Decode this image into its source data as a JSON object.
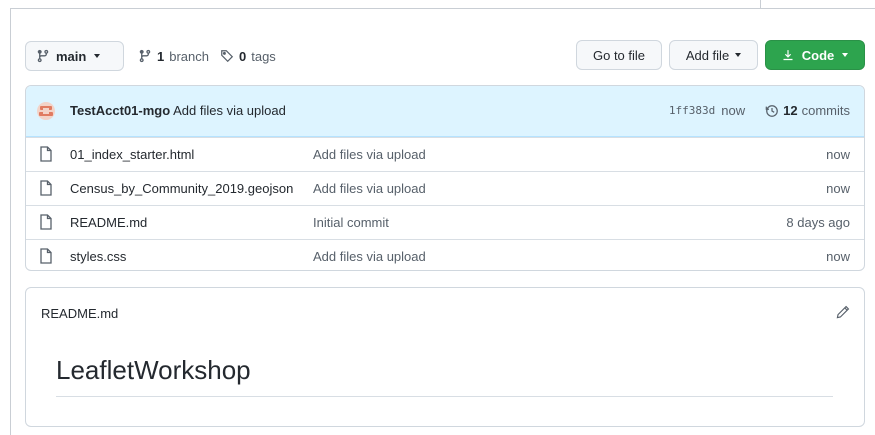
{
  "toolbar": {
    "branch_label": "main",
    "branch_count": "1",
    "branch_word": "branch",
    "tag_count": "0",
    "tag_word": "tags",
    "go_to_file": "Go to file",
    "add_file": "Add file",
    "code": "Code"
  },
  "commit": {
    "author": "TestAcct01-mgo",
    "message": "Add files via upload",
    "sha": "1ff383d",
    "when": "now",
    "commit_count": "12",
    "commit_word": "commits"
  },
  "files": [
    {
      "name": "01_index_starter.html",
      "commit": "Add files via upload",
      "age": "now"
    },
    {
      "name": "Census_by_Community_2019.geojson",
      "commit": "Add files via upload",
      "age": "now"
    },
    {
      "name": "README.md",
      "commit": "Initial commit",
      "age": "8 days ago"
    },
    {
      "name": "styles.css",
      "commit": "Add files via upload",
      "age": "now"
    }
  ],
  "readme": {
    "filename": "README.md",
    "heading": "LeafletWorkshop"
  },
  "colors": {
    "accent_green": "#2da44e",
    "commit_bar_bg": "#ddf4ff",
    "border": "#d0d7de"
  },
  "icons": [
    "git-branch-icon",
    "tag-icon",
    "download-icon",
    "history-icon",
    "file-icon",
    "pencil-icon",
    "avatar"
  ]
}
